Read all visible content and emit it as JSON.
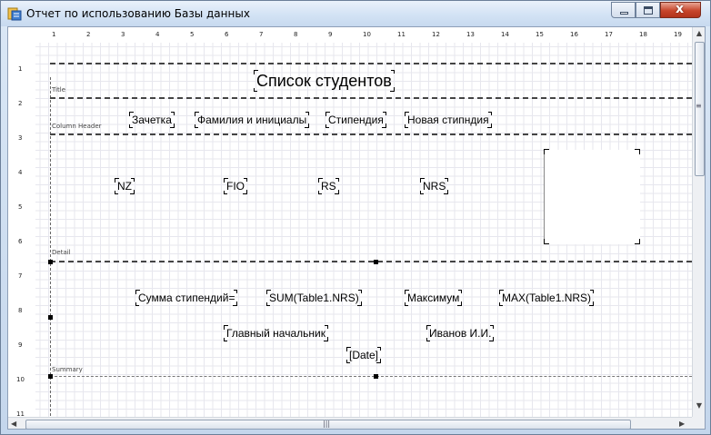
{
  "window": {
    "title": "Отчет по использованию Базы данных",
    "buttons": {
      "minimize": "minimize",
      "maximize": "maximize",
      "close": "x"
    }
  },
  "ruler": {
    "top": [
      "1",
      "2",
      "3",
      "4",
      "5",
      "6",
      "7",
      "8",
      "9",
      "10",
      "11",
      "12",
      "13",
      "14",
      "15",
      "16",
      "17",
      "18",
      "19"
    ],
    "left": [
      "1",
      "2",
      "3",
      "4",
      "5",
      "6",
      "7",
      "8",
      "9",
      "10",
      "11"
    ]
  },
  "bands": {
    "title": "Title",
    "column_header": "Column Header",
    "detail": "Detail",
    "summary": "Summary"
  },
  "title_band": {
    "caption": "Список студентов"
  },
  "column_header": {
    "zachetka": "Зачетка",
    "fio": "Фамилия и инициалы",
    "stipendia": "Стипендия",
    "new_stipendia": "Новая стипндия"
  },
  "detail": {
    "nz": "NZ",
    "fio": "FIO",
    "rs": "RS",
    "nrs": "NRS"
  },
  "summary": {
    "sum_label": "Сумма стипендий=",
    "sum_expr": "SUM(Table1.NRS)",
    "max_label": "Максимум",
    "max_expr": "MAX(Table1.NRS)",
    "chief_label": "Главный начальник",
    "chief_name": "Иванов И.И.",
    "date": "[Date]"
  },
  "colors": {
    "titlebar": "#d5e4f5",
    "close_button": "#c7452b",
    "grid": "#e7e7ee"
  }
}
